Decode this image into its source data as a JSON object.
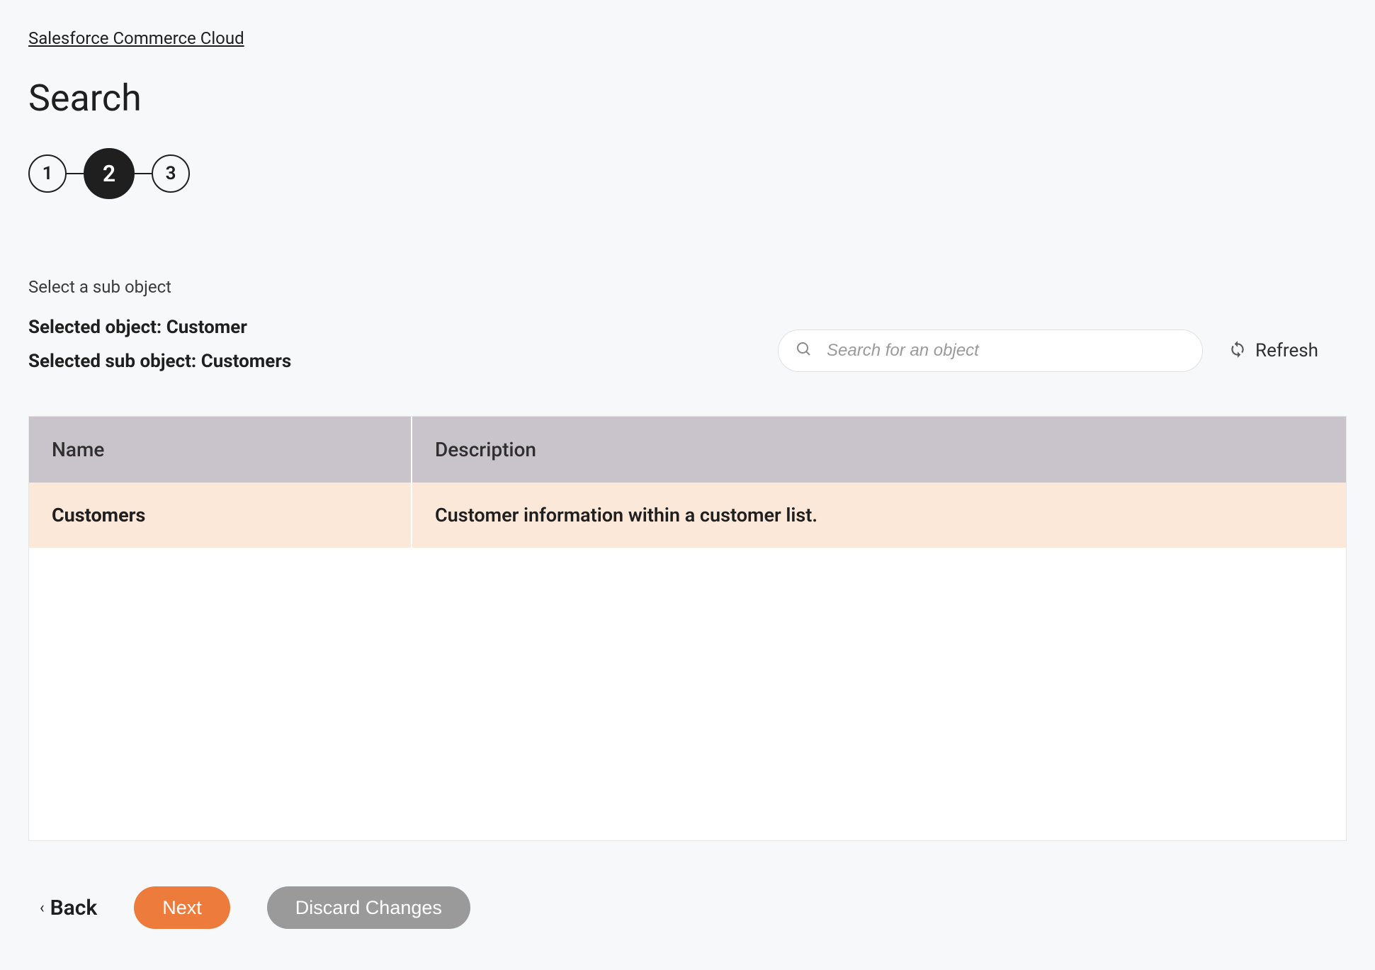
{
  "breadcrumb": "Salesforce Commerce Cloud",
  "page_title": "Search",
  "stepper": {
    "steps": [
      "1",
      "2",
      "3"
    ],
    "active_index": 1
  },
  "subheading": "Select a sub object",
  "selected_object_label": "Selected object: Customer",
  "selected_sub_object_label": "Selected sub object: Customers",
  "search": {
    "placeholder": "Search for an object"
  },
  "refresh_label": "Refresh",
  "table": {
    "columns": [
      "Name",
      "Description"
    ],
    "rows": [
      {
        "name": "Customers",
        "description": "Customer information within a customer list.",
        "selected": true
      }
    ]
  },
  "footer": {
    "back": "Back",
    "next": "Next",
    "discard": "Discard Changes"
  }
}
